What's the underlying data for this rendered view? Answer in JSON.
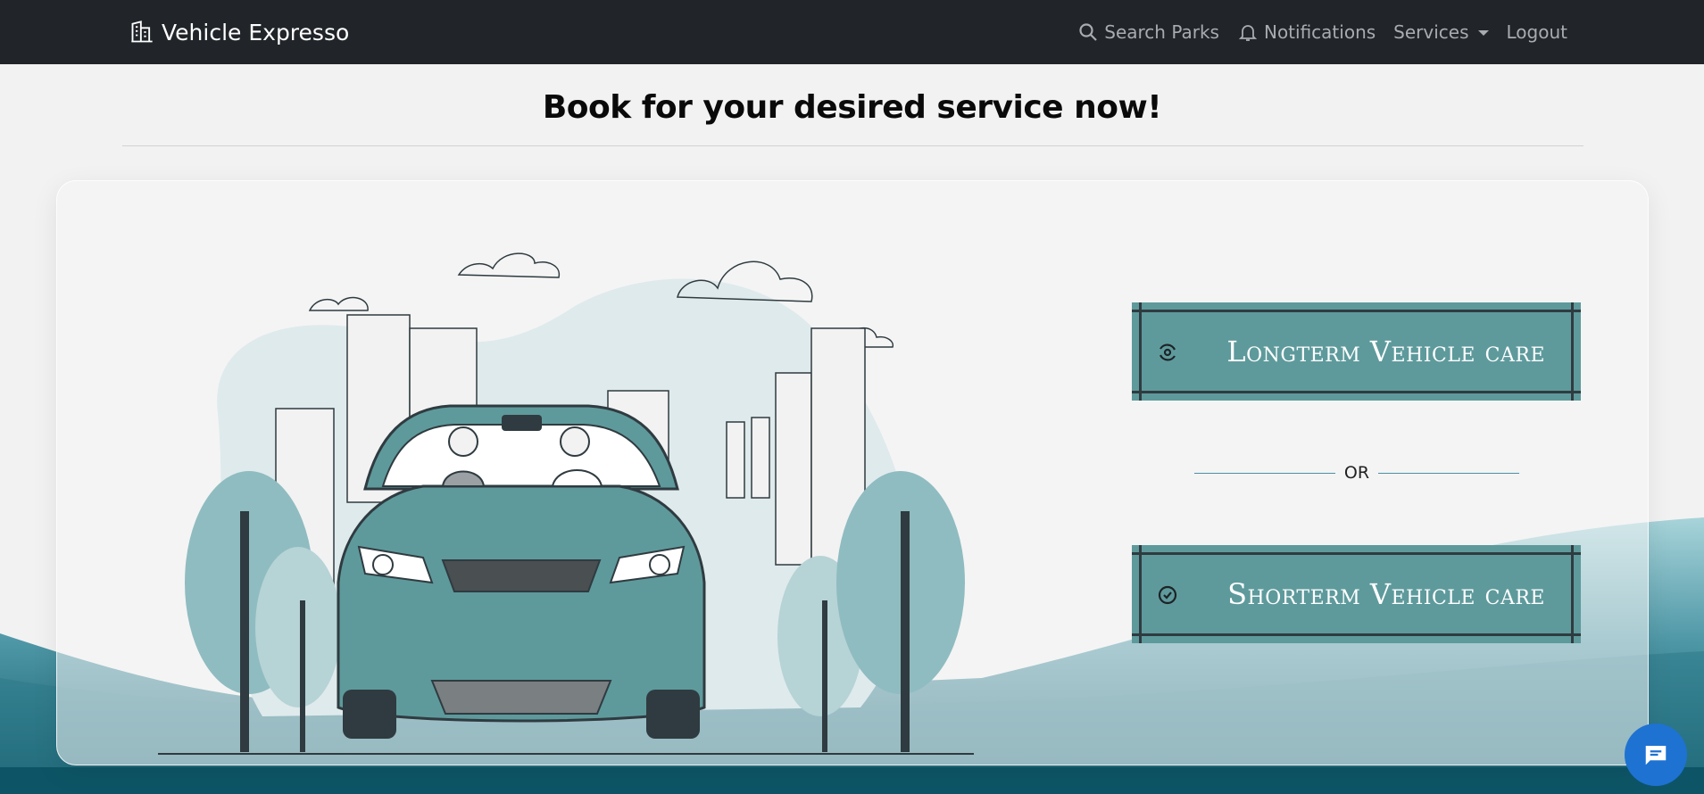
{
  "app": {
    "brand": "Vehicle Expresso",
    "brand_icon": "buildings-icon"
  },
  "nav": {
    "search_label": "Search Parks",
    "notifications_label": "Notifications",
    "services_label": "Services",
    "logout_label": "Logout"
  },
  "page": {
    "title": "Book for your desired service now!"
  },
  "services": {
    "longterm_label": "Longterm Vehicle care",
    "separator": "OR",
    "shortterm_label": "Shorterm Vehicle care"
  },
  "colors": {
    "navbar": "#212529",
    "button_teal": "#5e9a9c",
    "button_border": "#2f3b40",
    "chat_fab": "#1e72d2",
    "hills": "#2e7a8a"
  }
}
